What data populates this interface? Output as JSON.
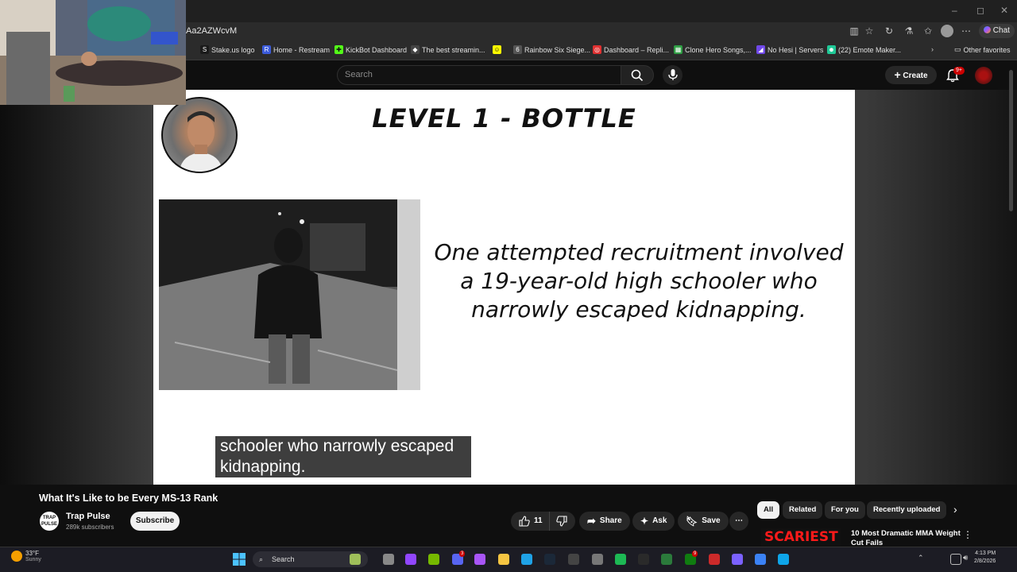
{
  "browser": {
    "url": "Aa2AZWcvM",
    "chat_label": "Chat",
    "window_controls": [
      "–",
      "◻",
      "✕"
    ],
    "bookmarks": [
      {
        "label": "Stake.us logo",
        "icon": "stake-icon",
        "color": "#1a1a1a",
        "glyph": "S"
      },
      {
        "label": "Home - Restream",
        "icon": "restream-icon",
        "color": "#3b5bdb",
        "glyph": "R"
      },
      {
        "label": "KickBot Dashboard",
        "icon": "kickbot-icon",
        "color": "#53fc18",
        "glyph": "✚"
      },
      {
        "label": "The best streamin...",
        "icon": "streaming-icon",
        "color": "#444444",
        "glyph": "◆"
      },
      {
        "label": "",
        "icon": "snapchat-icon",
        "color": "#fffc00",
        "glyph": "☺"
      },
      {
        "label": "Rainbow Six Siege...",
        "icon": "r6-icon",
        "color": "#555555",
        "glyph": "6"
      },
      {
        "label": "Dashboard – Repli...",
        "icon": "repli-icon",
        "color": "#e03131",
        "glyph": "◎"
      },
      {
        "label": "Clone Hero Songs,...",
        "icon": "sheets-icon",
        "color": "#2f9e44",
        "glyph": "▦"
      },
      {
        "label": "No Hesi | Servers",
        "icon": "nohesi-icon",
        "color": "#7048e8",
        "glyph": "◢"
      },
      {
        "label": "(22) Emote Maker...",
        "icon": "emote-icon",
        "color": "#20c997",
        "glyph": "☻"
      }
    ],
    "other_favorites": "Other favorites"
  },
  "youtube": {
    "search_placeholder": "Search",
    "create_label": "Create",
    "notif_count": "9+"
  },
  "slide": {
    "title": "LEVEL 1 - BOTTLE",
    "text_lines": [
      "One attempted recruitment involved",
      "a 19-year-old high schooler who",
      "narrowly escaped kidnapping."
    ],
    "caption_lines": [
      "schooler who narrowly escaped",
      "kidnapping."
    ]
  },
  "video": {
    "title": "What It's Like to be Every MS-13 Rank",
    "channel": "Trap Pulse",
    "channel_logo_text": "TRAP PULSE",
    "subscribers": "289k subscribers",
    "subscribe_label": "Subscribe",
    "likes": "11",
    "share_label": "Share",
    "ask_label": "Ask",
    "save_label": "Save"
  },
  "recommendations": {
    "chips": [
      "All",
      "Related",
      "For you",
      "Recently uploaded"
    ],
    "first_title": "10 Most Dramatic MMA Weight Cut Fails",
    "first_thumb_text": "SCARIEST"
  },
  "taskbar": {
    "weather_temp": "33°F",
    "weather_desc": "Sunny",
    "search_label": "Search",
    "time": "4:13 PM",
    "date": "2/8/2026",
    "discord_badge": "3",
    "xbox_badge": "9"
  }
}
